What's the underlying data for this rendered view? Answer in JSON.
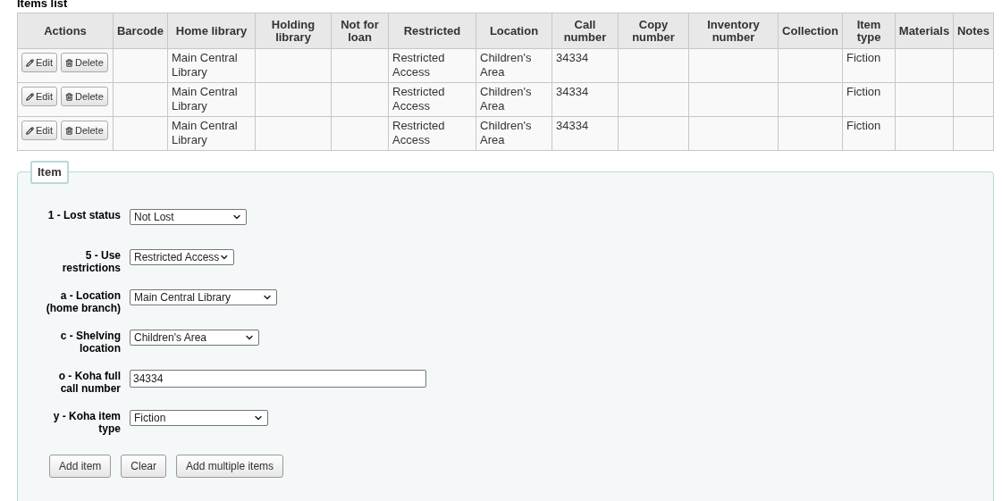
{
  "items_list": {
    "title": "Items list",
    "actions_column": "Actions",
    "columns": [
      "Barcode",
      "Home library",
      "Holding library",
      "Not for loan",
      "Restricted",
      "Location",
      "Call number",
      "Copy number",
      "Inventory number",
      "Collection",
      "Item type",
      "Materials",
      "Notes"
    ],
    "rows": [
      {
        "edit": "Edit",
        "delete": "Delete",
        "cells": [
          "",
          "Main Central Library",
          "",
          "",
          "Restricted Access",
          "Children's Area",
          "34334",
          "",
          "",
          "",
          "Fiction",
          "",
          ""
        ]
      },
      {
        "edit": "Edit",
        "delete": "Delete",
        "cells": [
          "",
          "Main Central Library",
          "",
          "",
          "Restricted Access",
          "Children's Area",
          "34334",
          "",
          "",
          "",
          "Fiction",
          "",
          ""
        ]
      },
      {
        "edit": "Edit",
        "delete": "Delete",
        "cells": [
          "",
          "Main Central Library",
          "",
          "",
          "Restricted Access",
          "Children's Area",
          "34334",
          "",
          "",
          "",
          "Fiction",
          "",
          ""
        ]
      }
    ]
  },
  "item_form": {
    "legend": "Item",
    "fields": [
      {
        "kind": "select",
        "label": "1 - Lost status",
        "value": "Not Lost"
      },
      {
        "kind": "select",
        "label": "5 - Use restrictions",
        "value": "Restricted Access"
      },
      {
        "kind": "select",
        "label": "a - Location (home branch)",
        "value": "Main Central Library"
      },
      {
        "kind": "select",
        "label": "c - Shelving location",
        "value": "Children's Area"
      },
      {
        "kind": "text",
        "label": "o - Koha full call number",
        "value": "34334"
      },
      {
        "kind": "select",
        "label": "y - Koha item type",
        "value": "Fiction"
      }
    ],
    "buttons": [
      "Add item",
      "Clear",
      "Add multiple items"
    ]
  }
}
